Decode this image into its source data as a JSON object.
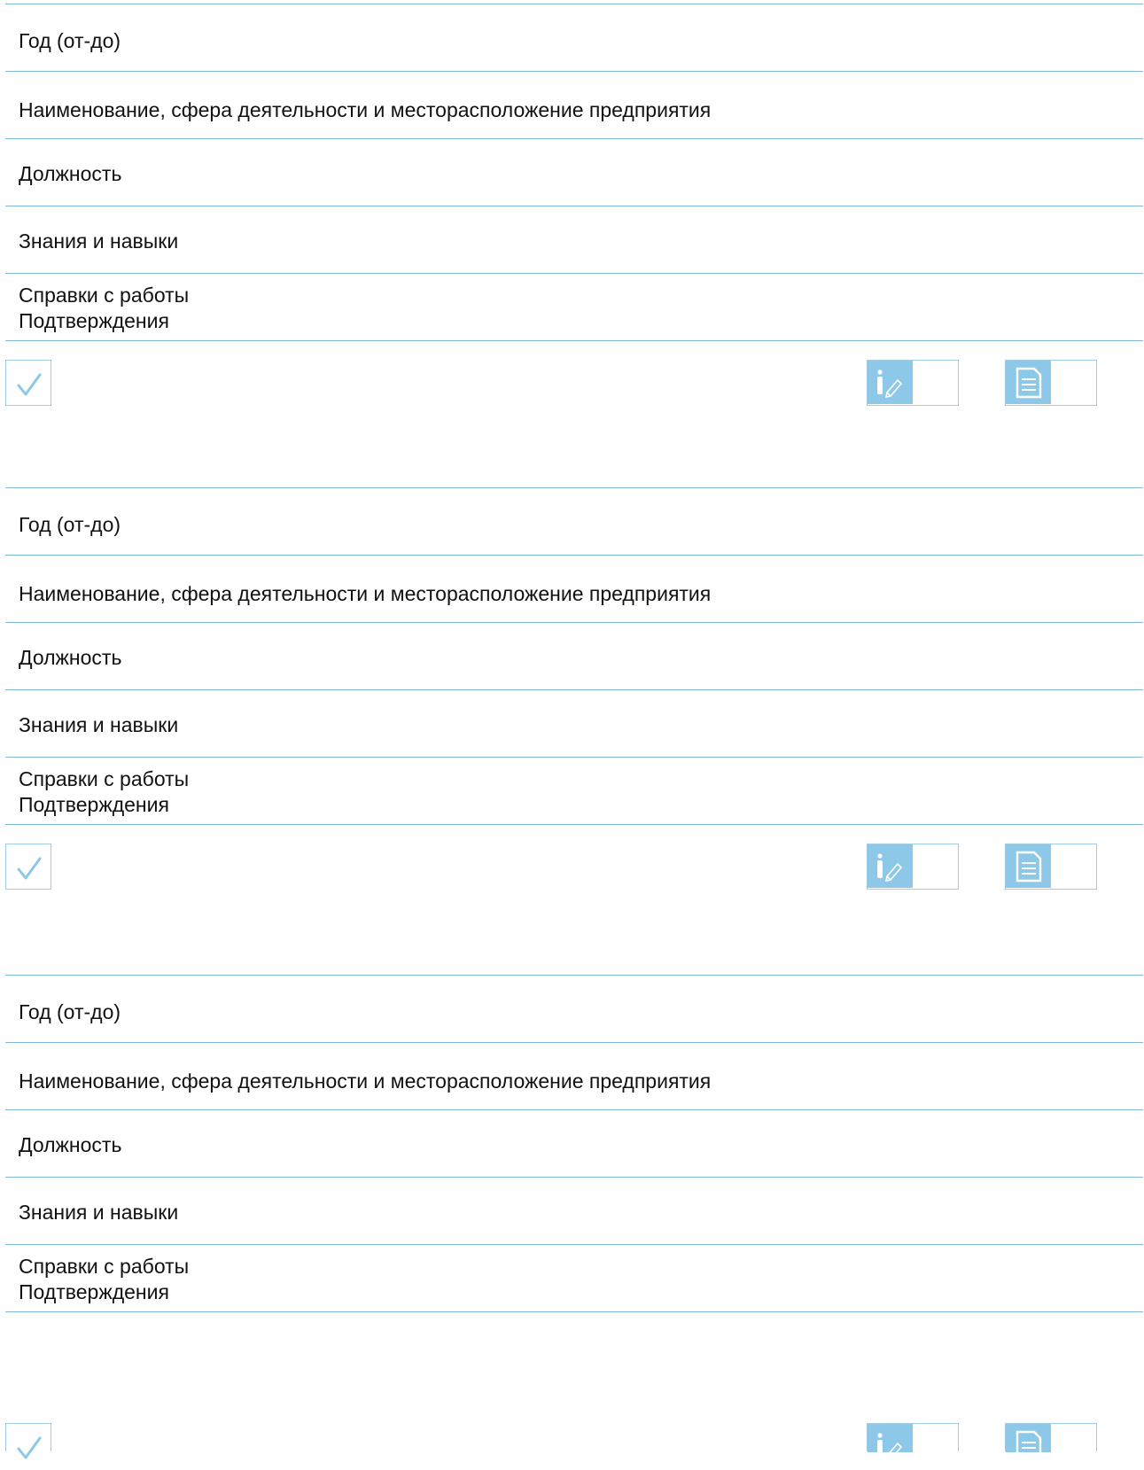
{
  "sections": [
    {
      "fields": [
        {
          "label": "Год (от-до)"
        },
        {
          "label": "Наименование, сфера деятельности и месторасположение предприятия"
        },
        {
          "label": "Должность"
        },
        {
          "label": "Знания и навыки"
        },
        {
          "label_line1": "Справки с работы",
          "label_line2": "Подтверждения"
        }
      ]
    },
    {
      "fields": [
        {
          "label": "Год (от-до)"
        },
        {
          "label": "Наименование, сфера деятельности и месторасположение предприятия"
        },
        {
          "label": "Должность"
        },
        {
          "label": "Знания и навыки"
        },
        {
          "label_line1": "Справки с работы",
          "label_line2": "Подтверждения"
        }
      ]
    },
    {
      "fields": [
        {
          "label": "Год (от-до)"
        },
        {
          "label": "Наименование, сфера деятельности и месторасположение предприятия"
        },
        {
          "label": "Должность"
        },
        {
          "label": "Знания и навыки"
        },
        {
          "label_line1": "Справки с работы",
          "label_line2": "Подтверждения"
        }
      ]
    }
  ],
  "icons": {
    "checkbox": "checkmark-icon",
    "info_edit": "info-edit-icon",
    "document": "document-icon"
  },
  "colors": {
    "line": "#7fb7d9",
    "icon_fill": "#8ec8e8",
    "check": "#8ec8e8"
  }
}
